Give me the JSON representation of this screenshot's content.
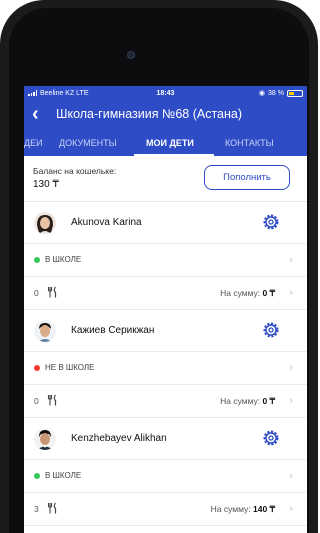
{
  "status_bar": {
    "carrier": "Beeline KZ LTE",
    "time": "18:43",
    "battery": "38 %",
    "battery_level": 0.38
  },
  "header": {
    "title": "Школа-гимназиия №68 (Астана)"
  },
  "tabs": [
    {
      "label": "ДЕИ",
      "active": false
    },
    {
      "label": "ДОКУМЕНТЫ",
      "active": false
    },
    {
      "label": "МОИ ДЕТИ",
      "active": true
    },
    {
      "label": "КОНТАКТЫ",
      "active": false
    }
  ],
  "wallet": {
    "label": "Баланс на кошельке:",
    "value": "130 ₸",
    "topup_label": "Пополнить"
  },
  "children": [
    {
      "name": "Akunova Karina",
      "status": "В ШКОЛЕ",
      "status_color": "#34c759",
      "meals": "0",
      "sum_label": "На сумму:",
      "sum_value": "0 ₸"
    },
    {
      "name": "Кажиев Серикжан",
      "status": "НЕ В ШКОЛЕ",
      "status_color": "#ff3b30",
      "meals": "0",
      "sum_label": "На сумму:",
      "sum_value": "0 ₸"
    },
    {
      "name": "Kenzhebayev Alikhan",
      "status": "В ШКОЛЕ",
      "status_color": "#34c759",
      "meals": "3",
      "sum_label": "На сумму:",
      "sum_value": "140 ₸"
    }
  ],
  "colors": {
    "accent": "#2f4cc7"
  },
  "icons": {
    "back": "back-arrow-icon",
    "gear": "settings-gear-icon",
    "meal": "fork-knife-icon",
    "chevron": "chevron-right-icon"
  }
}
